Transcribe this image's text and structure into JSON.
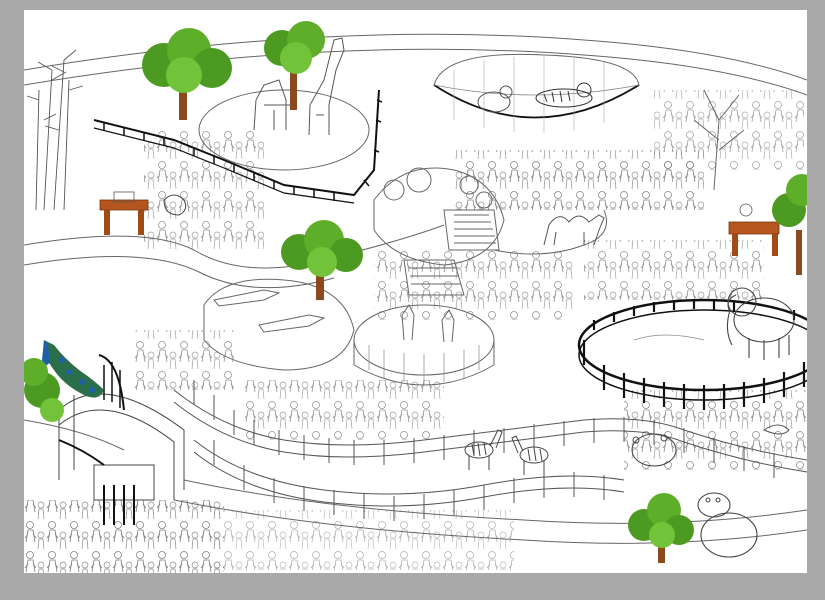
{
  "canvas": {
    "background": "#a9a9a9",
    "artboard_color": "#ffffff"
  },
  "scene": {
    "style": "coloring page line art",
    "line_color": "#555555",
    "fence_color": "#111111",
    "colored_elements": [
      {
        "name": "tree-icon",
        "color": "#5fae2a"
      },
      {
        "name": "tree-trunk-icon",
        "color": "#8b4a1e"
      },
      {
        "name": "bench-icon",
        "color": "#b5561f"
      },
      {
        "name": "peacock-icon",
        "color": "#1f5fa8"
      }
    ],
    "animals": [
      "giraffe",
      "tiger",
      "zebra",
      "elephant",
      "hippo",
      "crocodile",
      "camel",
      "peacock",
      "bear",
      "kangaroo",
      "bird"
    ]
  }
}
